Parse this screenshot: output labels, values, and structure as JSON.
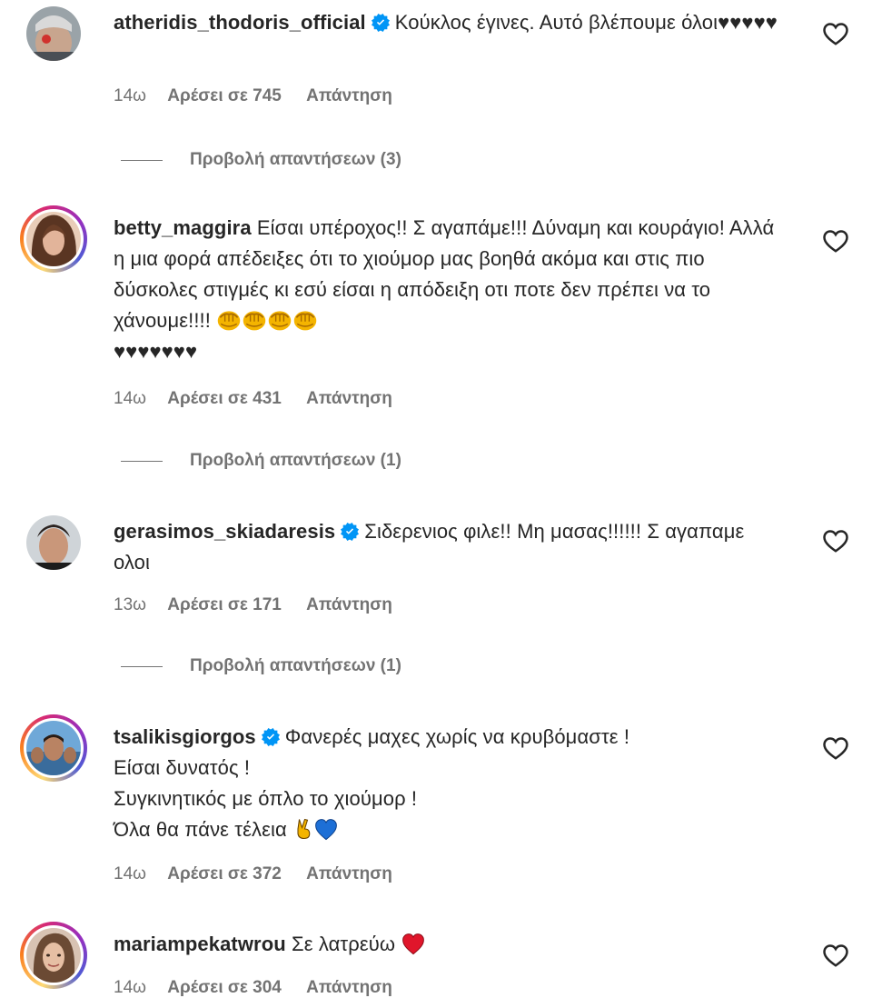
{
  "comments": [
    {
      "username": "atheridis_thodoris_official",
      "verified": true,
      "text": "Κούκλος έγινες. Αυτό βλέπουμε όλοι♥♥♥♥♥",
      "time": "14ω",
      "likes": "Αρέσει σε 745",
      "reply": "Απάντηση",
      "view_replies": "Προβολή απαντήσεων (3)"
    },
    {
      "username": "betty_maggira",
      "verified": false,
      "text": "Είσαι υπέροχος!! Σ αγαπάμε!!! Δύναμη και κουράγιο! Αλλά η μια φορά απέδειξες ότι το χιούμορ μας βοηθά ακόμα και στις πιο δύσκολες στιγμές κι εσύ είσαι η απόδειξη οτι ποτε δεν πρέπει να το χάνουμε!!!! ",
      "text_end": "♥♥♥♥♥♥♥",
      "time": "14ω",
      "likes": "Αρέσει σε 431",
      "reply": "Απάντηση",
      "view_replies": "Προβολή απαντήσεων (1)"
    },
    {
      "username": "gerasimos_skiadaresis",
      "verified": true,
      "text": "Σιδερενιος φιλε!! Μη μασας!!!!!! Σ αγαπαμε ολοι",
      "time": "13ω",
      "likes": "Αρέσει σε 171",
      "reply": "Απάντηση",
      "view_replies": "Προβολή απαντήσεων (1)"
    },
    {
      "username": "tsalikisgiorgos",
      "verified": true,
      "text_line1": "Φανερές μαχες χωρίς να κρυβόμαστε !",
      "text_line2": "Είσαι δυνατός !",
      "text_line3": "Συγκινητικός με όπλο το χιούμορ !",
      "text_line4": "Όλα θα πάνε τέλεια",
      "time": "14ω",
      "likes": "Αρέσει σε 372",
      "reply": "Απάντηση"
    },
    {
      "username": "mariampekatwrou",
      "verified": false,
      "text": "Σε λατρεύω",
      "time": "14ω",
      "likes": "Αρέσει σε 304",
      "reply": "Απάντηση"
    }
  ],
  "icons": {
    "like": "heart-outline-icon",
    "verified": "verified-badge-icon",
    "fist": "oncoming-fist-emoji",
    "victory": "victory-hand-emoji",
    "blue_heart": "blue-heart-emoji",
    "red_heart": "red-heart-emoji"
  },
  "colors": {
    "text": "#262626",
    "secondary": "#737373",
    "verified": "#0095f6",
    "story_ring_start": "#feda75",
    "story_ring_end": "#962fbf"
  }
}
